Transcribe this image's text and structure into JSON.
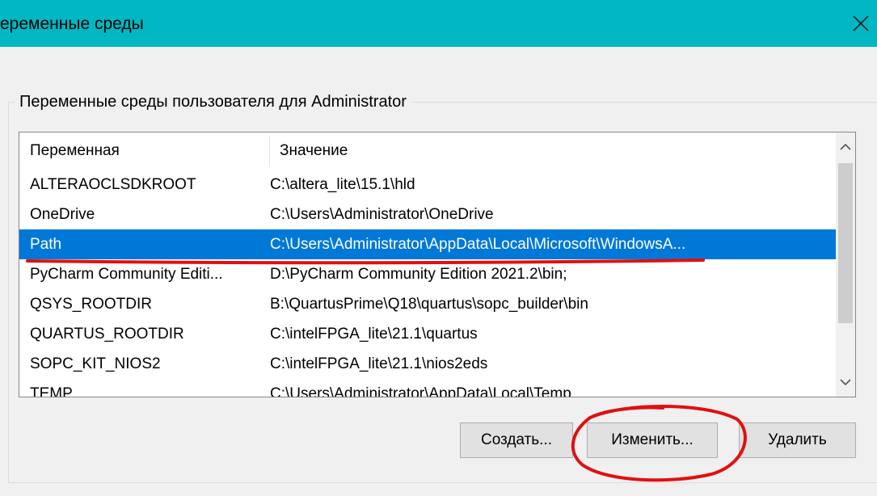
{
  "window": {
    "title": "еременные среды",
    "close_icon": "close-icon"
  },
  "user_vars": {
    "group_label": "Переменные среды пользователя для Administrator",
    "columns": {
      "name": "Переменная",
      "value": "Значение"
    },
    "rows": [
      {
        "name": "ALTERAOCLSDKROOT",
        "value": "C:\\altera_lite\\15.1\\hld"
      },
      {
        "name": "OneDrive",
        "value": "C:\\Users\\Administrator\\OneDrive"
      },
      {
        "name": "Path",
        "value": "C:\\Users\\Administrator\\AppData\\Local\\Microsoft\\WindowsA..."
      },
      {
        "name": "PyCharm Community Editi...",
        "value": "D:\\PyCharm Community Edition 2021.2\\bin;"
      },
      {
        "name": "QSYS_ROOTDIR",
        "value": "B:\\QuartusPrime\\Q18\\quartus\\sopc_builder\\bin"
      },
      {
        "name": "QUARTUS_ROOTDIR",
        "value": "C:\\intelFPGA_lite\\21.1\\quartus"
      },
      {
        "name": "SOPC_KIT_NIOS2",
        "value": "C:\\intelFPGA_lite\\21.1\\nios2eds"
      },
      {
        "name": "TEMP",
        "value": "C:\\Users\\Administrator\\AppData\\Local\\Temp"
      }
    ],
    "selected_row": "Path",
    "buttons": {
      "create": "Создать...",
      "edit": "Изменить...",
      "delete": "Удалить"
    }
  },
  "colors": {
    "titlebar": "#00b7c3",
    "selection": "#0078d7",
    "annotation": "#e01010"
  }
}
